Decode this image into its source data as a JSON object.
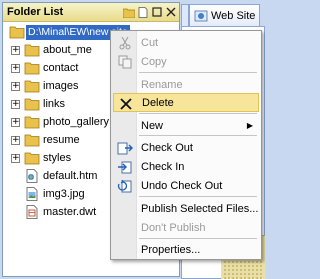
{
  "folder_list": {
    "title": "Folder List",
    "root_path": "D:\\Minal\\EW\\new site",
    "items": [
      {
        "label": "about_me",
        "type": "folder",
        "expandable": true
      },
      {
        "label": "contact",
        "type": "folder",
        "expandable": true
      },
      {
        "label": "images",
        "type": "folder",
        "expandable": true
      },
      {
        "label": "links",
        "type": "folder",
        "expandable": true
      },
      {
        "label": "photo_gallery",
        "type": "folder",
        "expandable": true
      },
      {
        "label": "resume",
        "type": "folder",
        "expandable": true
      },
      {
        "label": "styles",
        "type": "folder",
        "expandable": true
      },
      {
        "label": "default.htm",
        "type": "htm-file",
        "expandable": false
      },
      {
        "label": "img3.jpg",
        "type": "jpg-file",
        "expandable": false
      },
      {
        "label": "master.dwt",
        "type": "dwt-file",
        "expandable": false
      }
    ]
  },
  "tab": {
    "label": "Web Site"
  },
  "context_menu": {
    "cut": "Cut",
    "copy": "Copy",
    "rename": "Rename",
    "delete": "Delete",
    "new": "New",
    "check_out": "Check Out",
    "check_in": "Check In",
    "undo_check_out": "Undo Check Out",
    "publish_selected": "Publish Selected Files...",
    "dont_publish": "Don't Publish",
    "properties": "Properties...",
    "highlighted_item": "Delete"
  },
  "colors": {
    "selection": "#316ac5",
    "menu_highlight": "#f7e59a",
    "panel_header": "#efe5a8",
    "folder": "#e8c24a"
  }
}
